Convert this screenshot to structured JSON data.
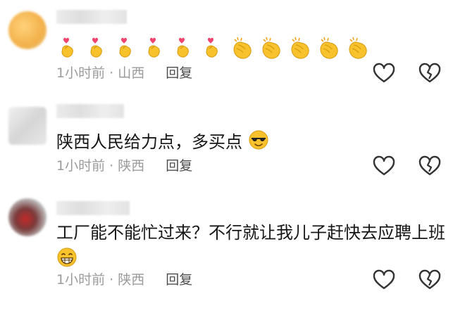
{
  "comments": [
    {
      "username": "",
      "emoji_row": {
        "count_finger_heart": 6,
        "count_clap": 5,
        "finger_heart_icon": "finger-heart-icon",
        "clap_icon": "clapping-hands-icon"
      },
      "time": "1小时前",
      "location": "山西",
      "reply_label": "回复"
    },
    {
      "username": "",
      "text": "陕西人民给力点，多买点",
      "trailing_emoji": "sunglasses-face-icon",
      "time": "1小时前",
      "location": "陕西",
      "reply_label": "回复"
    },
    {
      "username": "",
      "text": "工厂能不能忙过来？不行就让我儿子赶快去应聘上班",
      "trailing_emoji": "grinning-face-icon",
      "time": "1小时前",
      "location": "陕西",
      "reply_label": "回复"
    }
  ],
  "separator": " · ",
  "colors": {
    "meta_text": "#9b9b9b",
    "reply_text": "#4d4d4d",
    "icon_stroke": "#333333",
    "emoji_yellow": "#f7c22c",
    "heart_pink": "#f0436d"
  }
}
